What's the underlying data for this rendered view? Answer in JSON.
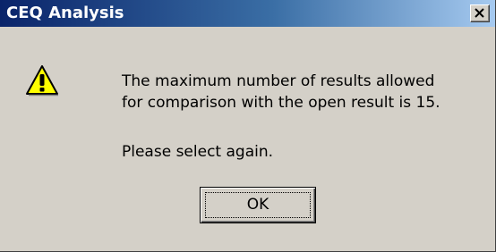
{
  "window": {
    "title": "CEQ Analysis",
    "close_icon": "close-icon",
    "titlebar_colors": [
      "#0a246a",
      "#a6caf0"
    ],
    "face_color": "#d4d0c8"
  },
  "message": {
    "icon": "warning-icon",
    "line1": "The maximum number of results allowed",
    "line2": "for comparison with the open result is 15.",
    "line3": "Please select again."
  },
  "buttons": {
    "ok_label": "OK"
  }
}
